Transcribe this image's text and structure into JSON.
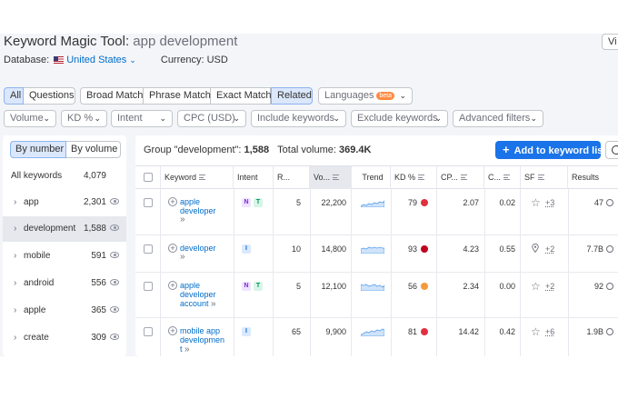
{
  "header": {
    "tool_title": "Keyword Magic Tool:",
    "keyword": "app development",
    "view_button": "Vi",
    "database_label": "Database:",
    "database_value": "United States",
    "currency": "Currency: USD"
  },
  "filters_row1": {
    "all": "All",
    "questions": "Questions",
    "broad_match": "Broad Match",
    "phrase_match": "Phrase Match",
    "exact_match": "Exact Match",
    "related": "Related",
    "languages": "Languages",
    "beta": "beta"
  },
  "filters_row2": {
    "volume": "Volume",
    "kd": "KD %",
    "intent": "Intent",
    "cpc": "CPC (USD)",
    "include": "Include keywords",
    "exclude": "Exclude keywords",
    "advanced": "Advanced filters"
  },
  "sidebar": {
    "by_number": "By number",
    "by_volume": "By volume",
    "all_label": "All keywords",
    "all_count": "4,079",
    "items": [
      {
        "label": "app",
        "count": "2,301"
      },
      {
        "label": "development",
        "count": "1,588"
      },
      {
        "label": "mobile",
        "count": "591"
      },
      {
        "label": "android",
        "count": "556"
      },
      {
        "label": "apple",
        "count": "365"
      },
      {
        "label": "create",
        "count": "309"
      }
    ]
  },
  "main": {
    "group_prefix": "Group \"development\":",
    "group_count": "1,588",
    "total_label": "Total volume:",
    "total_value": "369.4K",
    "add_button": "Add to keyword list",
    "columns": {
      "keyword": "Keyword",
      "intent": "Intent",
      "r": "R...",
      "volume": "Vo...",
      "trend": "Trend",
      "kd": "KD %",
      "cpc": "CP...",
      "c": "C...",
      "sf": "SF",
      "results": "Results"
    },
    "rows": [
      {
        "keyword_lines": [
          "apple",
          "developer"
        ],
        "intents": [
          "N",
          "T"
        ],
        "r": "5",
        "volume": "22,200",
        "kd": "79",
        "kd_color": "#e0303f",
        "cpc": "2.07",
        "com": "0.02",
        "sf_icon": "star-icon",
        "sf_count": "+3",
        "results": "47"
      },
      {
        "keyword_lines": [
          "developer"
        ],
        "intents": [
          "I"
        ],
        "r": "10",
        "volume": "14,800",
        "kd": "93",
        "kd_color": "#c0001e",
        "cpc": "4.23",
        "com": "0.55",
        "sf_icon": "map-pin-icon",
        "sf_count": "+2",
        "results": "7.7B"
      },
      {
        "keyword_lines": [
          "apple",
          "developer",
          "account"
        ],
        "intents": [
          "N",
          "T"
        ],
        "r": "5",
        "volume": "12,100",
        "kd": "56",
        "kd_color": "#f49a3a",
        "cpc": "2.34",
        "com": "0.00",
        "sf_icon": "star-icon",
        "sf_count": "+2",
        "results": "92"
      },
      {
        "keyword_lines": [
          "mobile app",
          "developmen",
          "t"
        ],
        "intents": [
          "I"
        ],
        "r": "65",
        "volume": "9,900",
        "kd": "81",
        "kd_color": "#e0303f",
        "cpc": "14.42",
        "com": "0.42",
        "sf_icon": "star-icon",
        "sf_count": "+6",
        "results": "1.9B"
      }
    ]
  },
  "colors": {
    "accent": "#1a73e8",
    "link": "#006dca",
    "active_filter": "#dbe7fb",
    "background": "#f4f5f9"
  }
}
